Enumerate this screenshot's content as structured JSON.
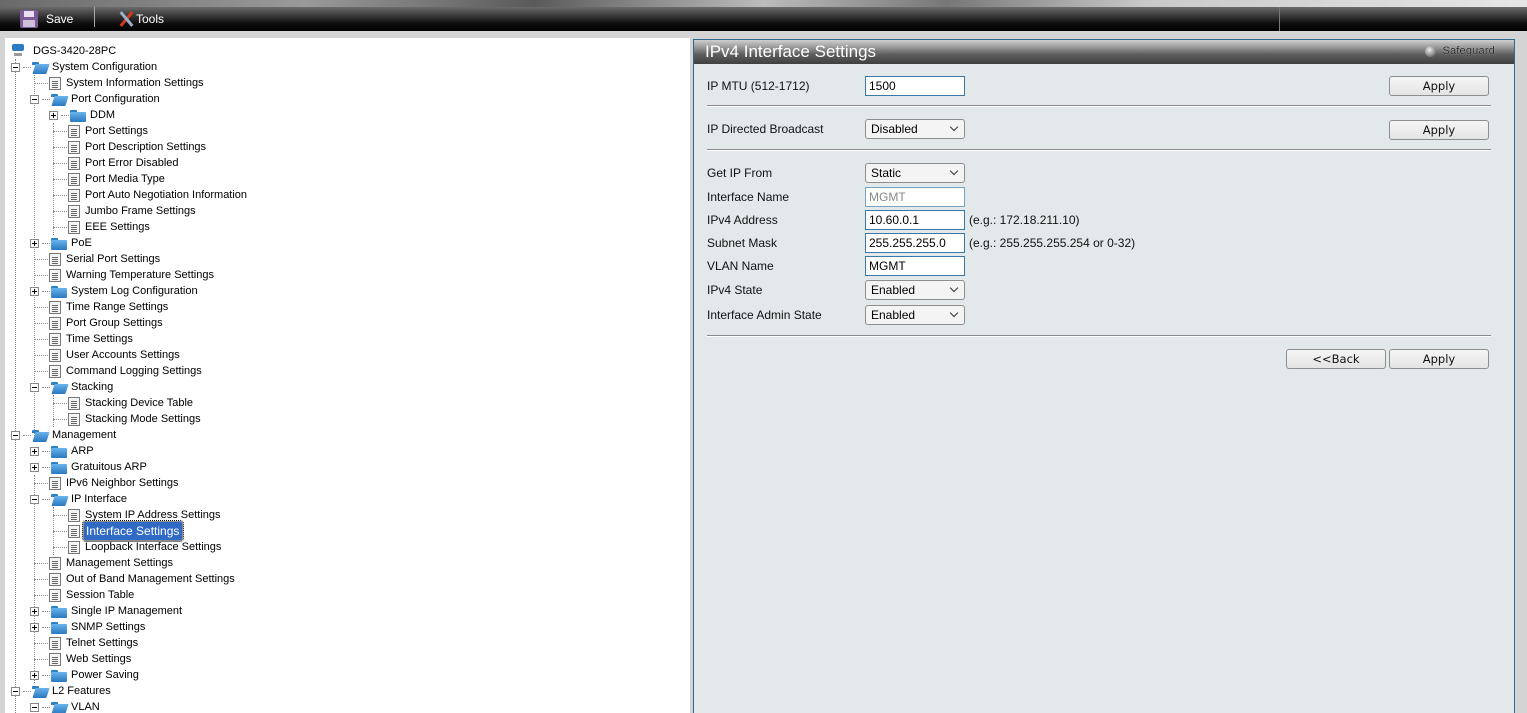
{
  "toolbar": {
    "save_label": "Save",
    "tools_label": "Tools"
  },
  "tree": {
    "root": "DGS-3420-28PC",
    "nodes": [
      {
        "label": "System Configuration",
        "type": "folder",
        "state": "expanded",
        "level": 1
      },
      {
        "label": "System Information Settings",
        "type": "page",
        "level": 2
      },
      {
        "label": "Port Configuration",
        "type": "folder",
        "state": "expanded",
        "level": 2
      },
      {
        "label": "DDM",
        "type": "folder",
        "state": "collapsed",
        "level": 3
      },
      {
        "label": "Port Settings",
        "type": "page",
        "level": 3
      },
      {
        "label": "Port Description Settings",
        "type": "page",
        "level": 3
      },
      {
        "label": "Port Error Disabled",
        "type": "page",
        "level": 3
      },
      {
        "label": "Port Media Type",
        "type": "page",
        "level": 3
      },
      {
        "label": "Port Auto Negotiation Information",
        "type": "page",
        "level": 3
      },
      {
        "label": "Jumbo Frame Settings",
        "type": "page",
        "level": 3
      },
      {
        "label": "EEE Settings",
        "type": "page",
        "level": 3
      },
      {
        "label": "PoE",
        "type": "folder",
        "state": "collapsed",
        "level": 2
      },
      {
        "label": "Serial Port Settings",
        "type": "page",
        "level": 2
      },
      {
        "label": "Warning Temperature Settings",
        "type": "page",
        "level": 2
      },
      {
        "label": "System Log Configuration",
        "type": "folder",
        "state": "collapsed",
        "level": 2
      },
      {
        "label": "Time Range Settings",
        "type": "page",
        "level": 2
      },
      {
        "label": "Port Group Settings",
        "type": "page",
        "level": 2
      },
      {
        "label": "Time Settings",
        "type": "page",
        "level": 2
      },
      {
        "label": "User Accounts Settings",
        "type": "page",
        "level": 2
      },
      {
        "label": "Command Logging Settings",
        "type": "page",
        "level": 2
      },
      {
        "label": "Stacking",
        "type": "folder",
        "state": "expanded",
        "level": 2
      },
      {
        "label": "Stacking Device Table",
        "type": "page",
        "level": 3
      },
      {
        "label": "Stacking Mode Settings",
        "type": "page",
        "level": 3
      },
      {
        "label": "Management",
        "type": "folder",
        "state": "expanded",
        "level": 1
      },
      {
        "label": "ARP",
        "type": "folder",
        "state": "collapsed",
        "level": 2
      },
      {
        "label": "Gratuitous ARP",
        "type": "folder",
        "state": "collapsed",
        "level": 2
      },
      {
        "label": "IPv6 Neighbor Settings",
        "type": "page",
        "level": 2
      },
      {
        "label": "IP Interface",
        "type": "folder",
        "state": "expanded",
        "level": 2
      },
      {
        "label": "System IP Address Settings",
        "type": "page",
        "level": 3
      },
      {
        "label": "Interface Settings",
        "type": "page",
        "level": 3,
        "selected": true
      },
      {
        "label": "Loopback Interface Settings",
        "type": "page",
        "level": 3
      },
      {
        "label": "Management Settings",
        "type": "page",
        "level": 2
      },
      {
        "label": "Out of Band Management Settings",
        "type": "page",
        "level": 2
      },
      {
        "label": "Session Table",
        "type": "page",
        "level": 2
      },
      {
        "label": "Single IP Management",
        "type": "folder",
        "state": "collapsed",
        "level": 2
      },
      {
        "label": "SNMP Settings",
        "type": "folder",
        "state": "collapsed",
        "level": 2
      },
      {
        "label": "Telnet Settings",
        "type": "page",
        "level": 2
      },
      {
        "label": "Web Settings",
        "type": "page",
        "level": 2
      },
      {
        "label": "Power Saving",
        "type": "folder",
        "state": "collapsed",
        "level": 2
      },
      {
        "label": "L2 Features",
        "type": "folder",
        "state": "expanded",
        "level": 1
      },
      {
        "label": "VLAN",
        "type": "folder",
        "state": "expanded",
        "level": 2
      }
    ]
  },
  "panel": {
    "title": "IPv4 Interface Settings",
    "safeguard_label": "Safeguard",
    "mtu": {
      "label": "IP MTU (512-1712)",
      "value": "1500",
      "apply": "Apply"
    },
    "broadcast": {
      "label": "IP Directed Broadcast",
      "value": "Disabled",
      "apply": "Apply"
    },
    "fields": {
      "get_ip_from": {
        "label": "Get IP From",
        "value": "Static"
      },
      "interface_name": {
        "label": "Interface Name",
        "value": "MGMT"
      },
      "ipv4_address": {
        "label": "IPv4 Address",
        "value": "10.60.0.1",
        "hint": "(e.g.: 172.18.211.10)"
      },
      "subnet_mask": {
        "label": "Subnet Mask",
        "value": "255.255.255.0",
        "hint": "(e.g.: 255.255.255.254 or 0-32)"
      },
      "vlan_name": {
        "label": "VLAN Name",
        "value": "MGMT"
      },
      "ipv4_state": {
        "label": "IPv4 State",
        "value": "Enabled"
      },
      "admin_state": {
        "label": "Interface Admin State",
        "value": "Enabled"
      }
    },
    "back_label": "<<Back",
    "apply_label": "Apply"
  }
}
